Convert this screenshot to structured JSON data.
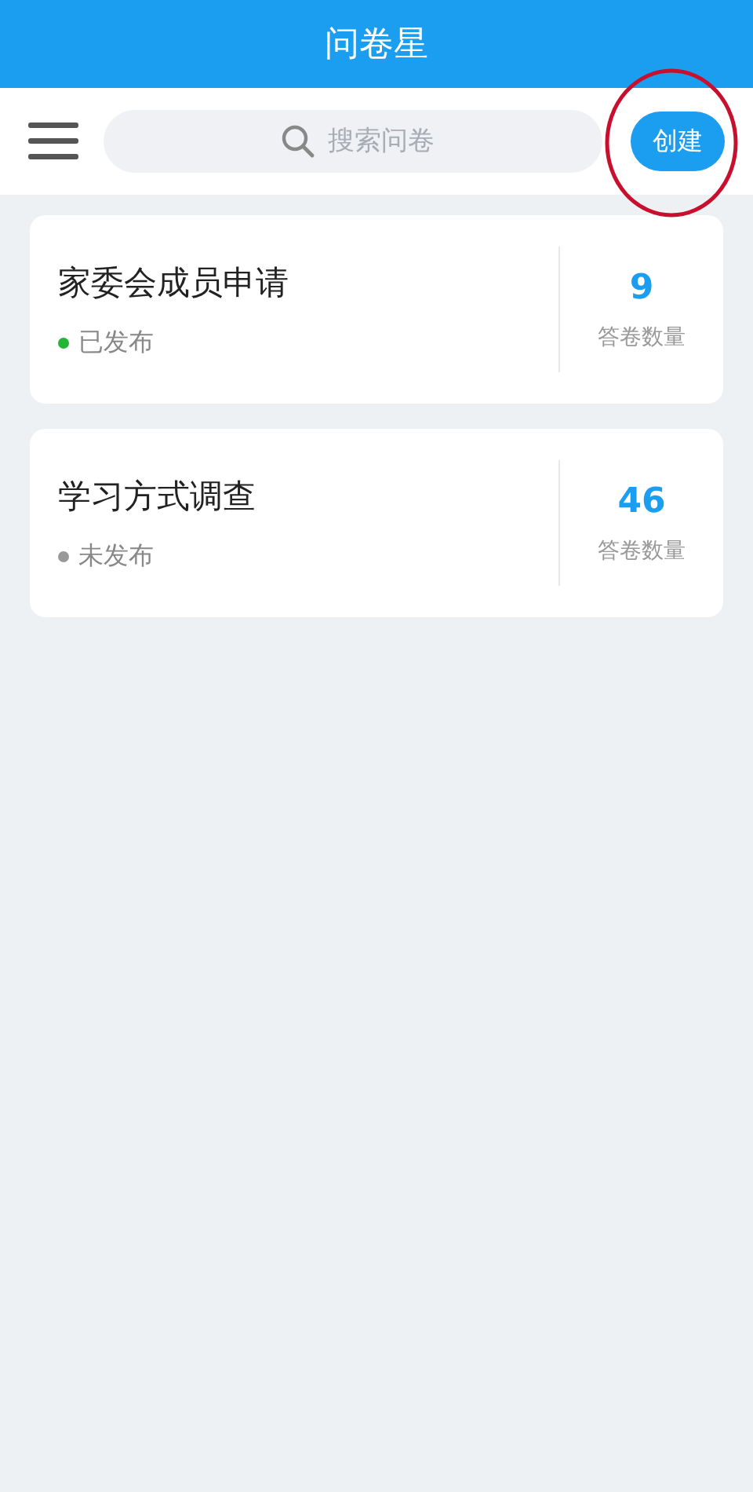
{
  "header": {
    "title": "问卷星"
  },
  "toolbar": {
    "search": {
      "placeholder": "搜索问卷"
    },
    "create_button": "创建"
  },
  "surveys": [
    {
      "title": "家委会成员申请",
      "status": "已发布",
      "published": true,
      "count": "9",
      "count_label": "答卷数量"
    },
    {
      "title": "学习方式调查",
      "status": "未发布",
      "published": false,
      "count": "46",
      "count_label": "答卷数量"
    }
  ]
}
